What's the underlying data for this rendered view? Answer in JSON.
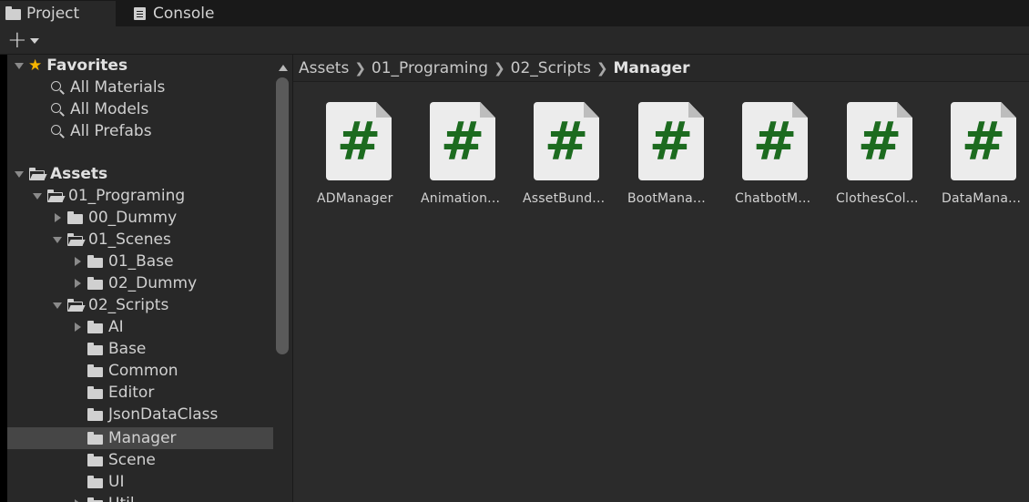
{
  "tabs": [
    {
      "label": "Project",
      "icon": "folder-icon",
      "active": true
    },
    {
      "label": "Console",
      "icon": "console-icon",
      "active": false
    }
  ],
  "toolbar": {
    "add_symbol": "+"
  },
  "tree": {
    "favorites": {
      "label": "Favorites",
      "items": [
        "All Materials",
        "All Models",
        "All Prefabs"
      ]
    },
    "assets_label": "Assets",
    "nodes": [
      {
        "label": "01_Programing"
      },
      {
        "label": "00_Dummy"
      },
      {
        "label": "01_Scenes"
      },
      {
        "label": "01_Base"
      },
      {
        "label": "02_Dummy"
      },
      {
        "label": "02_Scripts"
      },
      {
        "label": "AI"
      },
      {
        "label": "Base"
      },
      {
        "label": "Common"
      },
      {
        "label": "Editor"
      },
      {
        "label": "JsonDataClass"
      },
      {
        "label": "Manager"
      },
      {
        "label": "Scene"
      },
      {
        "label": "UI"
      },
      {
        "label": "Util"
      }
    ]
  },
  "breadcrumb": [
    "Assets",
    "01_Programing",
    "02_Scripts",
    "Manager"
  ],
  "assets": [
    {
      "label": "ADManager",
      "glyph": "#"
    },
    {
      "label": "Animation...",
      "glyph": "#"
    },
    {
      "label": "AssetBund...",
      "glyph": "#"
    },
    {
      "label": "BootMana...",
      "glyph": "#"
    },
    {
      "label": "ChatbotM...",
      "glyph": "#"
    },
    {
      "label": "ClothesCol...",
      "glyph": "#"
    },
    {
      "label": "DataMana...",
      "glyph": "#"
    }
  ],
  "colors": {
    "script_green": "#1c6b1f",
    "favorite_star": "#f5b400",
    "selection": "#464646"
  }
}
